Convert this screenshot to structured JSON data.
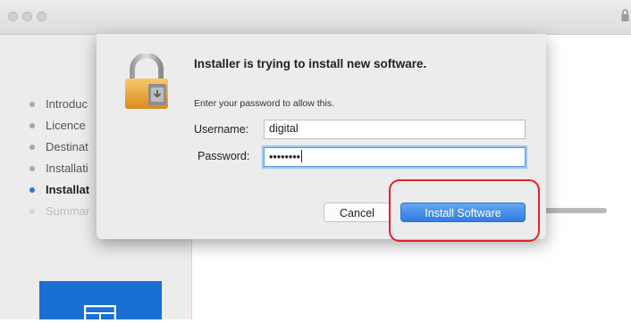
{
  "installer": {
    "steps": [
      {
        "label": "Introduc",
        "state": "done"
      },
      {
        "label": "Licence",
        "state": "done"
      },
      {
        "label": "Destinat",
        "state": "done"
      },
      {
        "label": "Installati",
        "state": "done"
      },
      {
        "label": "Installat",
        "state": "active"
      },
      {
        "label": "Summar",
        "state": "pending"
      }
    ]
  },
  "dialog": {
    "title": "Installer is trying to install new software.",
    "subtitle": "Enter your password to allow this.",
    "username_label": "Username:",
    "username_value": "digital",
    "password_label": "Password:",
    "password_value": "••••••••",
    "cancel_label": "Cancel",
    "install_label": "Install Software"
  },
  "colors": {
    "accent": "#2f7de0",
    "highlight": "#e3212b",
    "brand": "#1a6fd4"
  },
  "icons": [
    "lock-icon",
    "padlock-icon",
    "installer-logo-icon"
  ]
}
